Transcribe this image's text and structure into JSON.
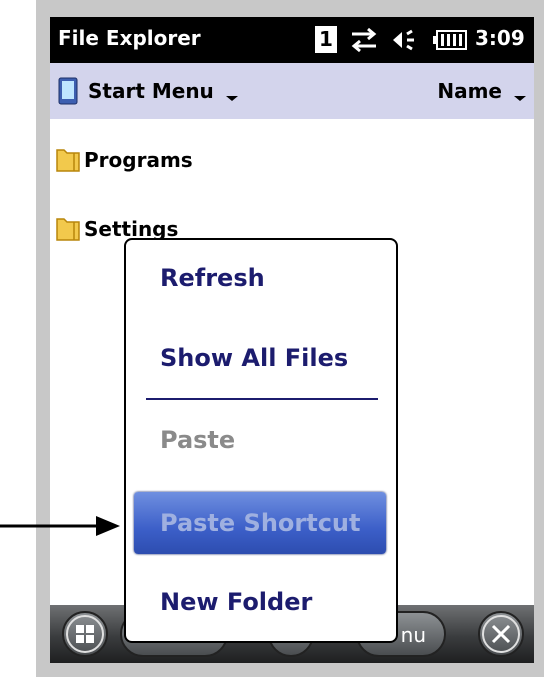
{
  "status_bar": {
    "app_title": "File Explorer",
    "sim_indicator": "1",
    "clock": "3:09",
    "icons": [
      "connectivity-icon",
      "volume-icon",
      "battery-icon"
    ]
  },
  "location_bar": {
    "location": "Start Menu",
    "sort_by": "Name"
  },
  "file_list": [
    {
      "label": "Programs",
      "icon": "folder-icon"
    },
    {
      "label": "Settings",
      "icon": "folder-icon"
    }
  ],
  "context_menu": {
    "items": [
      {
        "label": "Refresh",
        "enabled": true
      },
      {
        "label": "Show All Files",
        "enabled": true
      },
      {
        "label": "Paste",
        "enabled": false
      },
      {
        "label": "Paste Shortcut",
        "enabled": false,
        "highlighted": true
      },
      {
        "label": "New Folder",
        "enabled": true
      }
    ]
  },
  "taskbar": {
    "menu_button_partial": "nu",
    "icons": [
      "windows-start-icon",
      "close-icon"
    ]
  },
  "colors": {
    "status_bar_bg": "#000000",
    "location_bar_bg": "#d3d4ec",
    "menu_text": "#1c1c6e",
    "menu_disabled_text": "#8a8a8a",
    "highlight": "#3c5fc8"
  }
}
